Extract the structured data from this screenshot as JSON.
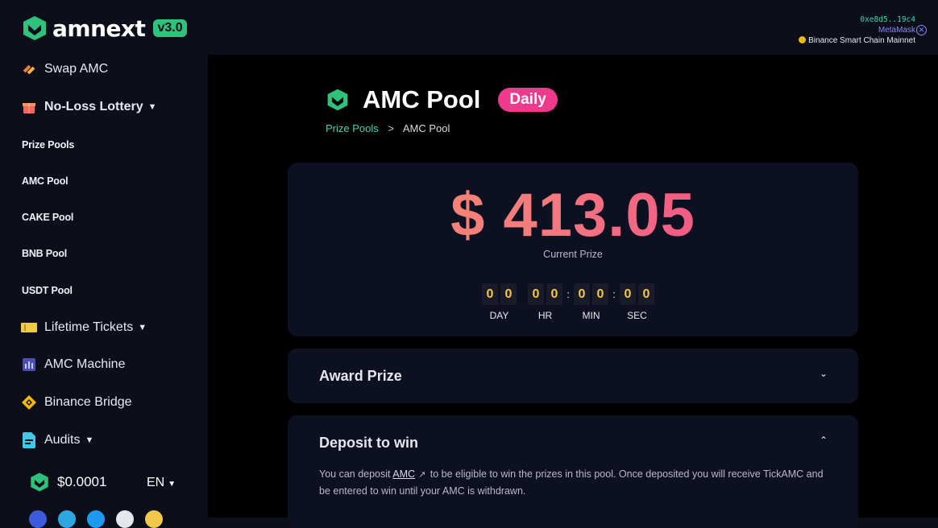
{
  "brand": {
    "name": "amnext",
    "version": "v3.0"
  },
  "wallet": {
    "address": "0xe8d5..19c4",
    "provider": "MetaMask",
    "network": "Binance Smart Chain Mainnet"
  },
  "sidebar": {
    "swap": "Swap AMC",
    "lottery": "No-Loss Lottery",
    "lottery_items": [
      "Prize Pools",
      "AMC Pool",
      "CAKE Pool",
      "BNB Pool",
      "USDT Pool"
    ],
    "lifetime": "Lifetime Tickets",
    "machine": "AMC Machine",
    "bridge": "Binance Bridge",
    "audits": "Audits",
    "price": "$0.0001",
    "language": "EN"
  },
  "pool": {
    "title": "AMC Pool",
    "badge": "Daily",
    "breadcrumb_link": "Prize Pools",
    "breadcrumb_sep": ">",
    "breadcrumb_current": "AMC Pool"
  },
  "prize": {
    "amount": "$ 413.05",
    "label": "Current Prize",
    "countdown": {
      "day": [
        "0",
        "0"
      ],
      "hr": [
        "0",
        "0"
      ],
      "min": [
        "0",
        "0"
      ],
      "sec": [
        "0",
        "0"
      ],
      "labels": {
        "day": "DAY",
        "hr": "HR",
        "min": "MIN",
        "sec": "SEC"
      }
    }
  },
  "award": {
    "title": "Award Prize"
  },
  "deposit": {
    "title": "Deposit to win",
    "text_before": "You can deposit ",
    "link": "AMC",
    "text_after": " to be eligible to win the prizes in this pool. Once deposited you will receive TickAMC and be entered to win until your AMC is withdrawn."
  },
  "colors": {
    "accent_green": "#2ec27a",
    "teal_link": "#3fd3b0",
    "pink_badge": "#ee3a8c",
    "digit_yellow": "#f0c94a",
    "card_bg": "#0d1020"
  }
}
